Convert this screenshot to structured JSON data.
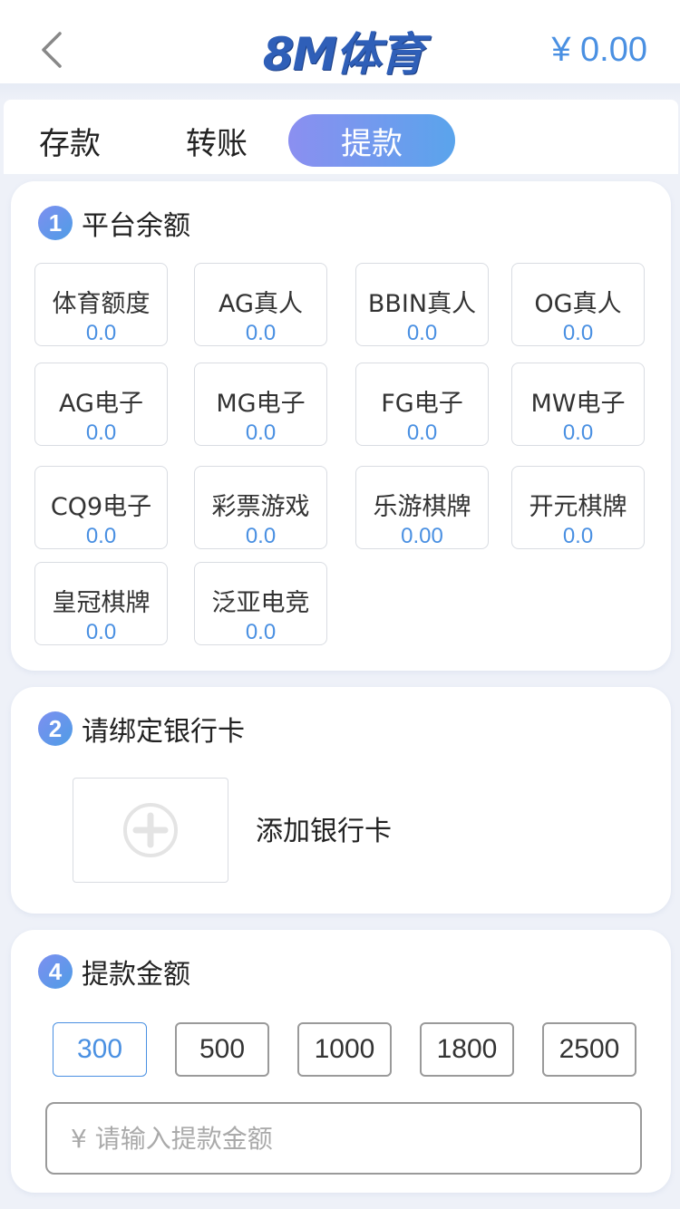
{
  "header": {
    "logo_text": "8M体育",
    "balance": "¥ 0.00",
    "back_icon": "chevron-left-icon"
  },
  "tabs": [
    {
      "label": "存款",
      "active": false
    },
    {
      "label": "转账",
      "active": false
    },
    {
      "label": "提款",
      "active": true
    }
  ],
  "platforms_section": {
    "number": "1",
    "title": "平台余额",
    "items": [
      {
        "name": "体育额度",
        "value": "0.0"
      },
      {
        "name": "AG真人",
        "value": "0.0"
      },
      {
        "name": "BBIN真人",
        "value": "0.0"
      },
      {
        "name": "OG真人",
        "value": "0.0"
      },
      {
        "name": "AG电子",
        "value": "0.0"
      },
      {
        "name": "MG电子",
        "value": "0.0"
      },
      {
        "name": "FG电子",
        "value": "0.0"
      },
      {
        "name": "MW电子",
        "value": "0.0"
      },
      {
        "name": "CQ9电子",
        "value": "0.0"
      },
      {
        "name": "彩票游戏",
        "value": "0.0"
      },
      {
        "name": "乐游棋牌",
        "value": "0.00"
      },
      {
        "name": "开元棋牌",
        "value": "0.0"
      },
      {
        "name": "皇冠棋牌",
        "value": "0.0"
      },
      {
        "name": "泛亚电竞",
        "value": "0.0"
      }
    ]
  },
  "bank_section": {
    "number": "2",
    "title": "请绑定银行卡",
    "add_label": "添加银行卡",
    "add_icon": "plus-circle-icon"
  },
  "amount_section": {
    "number": "4",
    "title": "提款金额",
    "presets": [
      "300",
      "500",
      "1000",
      "1800",
      "2500"
    ],
    "selected": "300",
    "input_placeholder": "¥ 请输入提款金额"
  },
  "colors": {
    "accent": "#4a90e2",
    "tab_gradient_start": "#8b8ff0",
    "tab_gradient_end": "#5aa4ec",
    "background": "#eef1f8",
    "logo": "#2f5fb8"
  }
}
